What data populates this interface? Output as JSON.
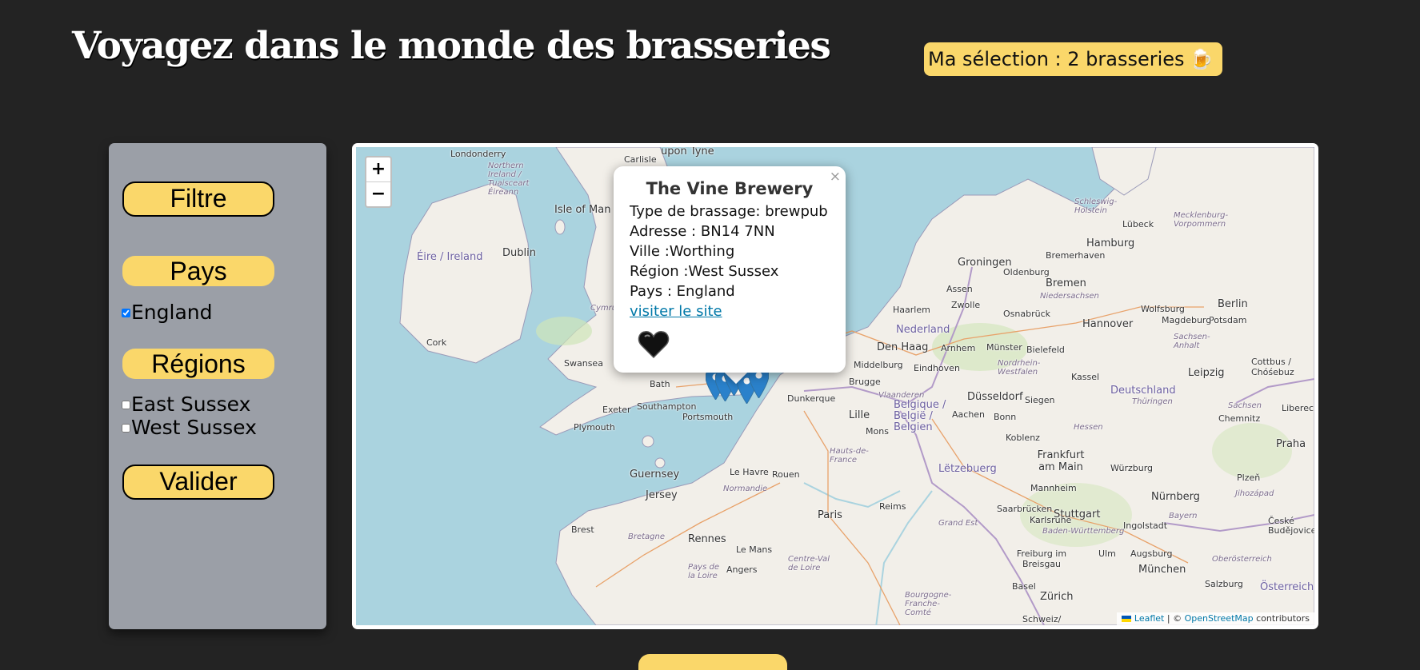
{
  "header": {
    "title": "Voyagez dans le monde des brasseries",
    "selection_label": "Ma sélection : 2 brasseries",
    "selection_icon": "🍺"
  },
  "sidebar": {
    "filter_button": "Filtre",
    "countries_heading": "Pays",
    "countries": [
      {
        "label": "England",
        "checked": true
      }
    ],
    "regions_heading": "Régions",
    "regions": [
      {
        "label": "East Sussex",
        "checked": false
      },
      {
        "label": "West Sussex",
        "checked": false
      }
    ],
    "submit_button": "Valider"
  },
  "map": {
    "zoom_in": "+",
    "zoom_out": "−",
    "places": {
      "londonderry": "Londonderry",
      "carlisle": "Carlisle",
      "upon_tyne": "upon Tyne",
      "northern_ireland": "Northern Ireland / Tuaisceart Éireann",
      "isle_of_man": "Isle of Man",
      "dublin": "Dublin",
      "eire": "Éire / Ireland",
      "cork": "Cork",
      "cymru": "Cymru",
      "swansea": "Swansea",
      "bath": "Bath",
      "exeter": "Exeter",
      "southampton": "Southampton",
      "portsmouth": "Portsmouth",
      "plymouth": "Plymouth",
      "guernsey": "Guernsey",
      "jersey": "Jersey",
      "le_havre": "Le Havre",
      "rouen": "Rouen",
      "normandie": "Normandie",
      "brest": "Brest",
      "bretagne": "Bretagne",
      "rennes": "Rennes",
      "le_mans": "Le Mans",
      "angers": "Angers",
      "pays_de_la_loire": "Pays de la Loire",
      "centre_val": "Centre-Val de Loire",
      "paris": "Paris",
      "reims": "Reims",
      "grand_est": "Grand Est",
      "hauts_de_france": "Hauts-de-France",
      "lille": "Lille",
      "dunkerque": "Dunkerque",
      "belgique": "Belgique / België / Belgien",
      "mons": "Mons",
      "bruxelles": "Brugge",
      "vlaanderen": "Vlaanderen",
      "middelburg": "Middelburg",
      "den_haag": "Den Haag",
      "nederland": "Nederland",
      "haarlem": "Haarlem",
      "zwolle": "Zwolle",
      "assen": "Assen",
      "groningen": "Groningen",
      "arnhem": "Arnhem",
      "eindhoven": "Eindhoven",
      "letzebuerg": "Lëtzebuerg",
      "dusseldorf": "Düsseldorf",
      "aachen": "Aachen",
      "bonn": "Bonn",
      "siegen": "Siegen",
      "koblenz": "Koblenz",
      "munster": "Münster",
      "bielefeld": "Bielefeld",
      "nordrhein": "Nordrhein-Westfalen",
      "hessen": "Hessen",
      "frankfurt": "Frankfurt am Main",
      "mannheim": "Mannheim",
      "saarbrucken": "Saarbrücken",
      "karlsruhe": "Karlsruhe",
      "stuttgart": "Stuttgart",
      "baden": "Baden-Württemberg",
      "freiburg": "Freiburg im Breisgau",
      "basel": "Basel",
      "zurich": "Zürich",
      "schweiz": "Schweiz/",
      "ulm": "Ulm",
      "munchen": "München",
      "augsburg": "Augsburg",
      "bayern": "Bayern",
      "nurnberg": "Nürnberg",
      "wurzburg": "Würzburg",
      "ingolstadt": "Ingolstadt",
      "deutschland": "Deutschland",
      "kassel": "Kassel",
      "hannover": "Hannover",
      "bremen": "Bremen",
      "bremerhaven": "Bremerhaven",
      "oldenburg": "Oldenburg",
      "osnabruck": "Osnabrück",
      "niedersachsen": "Niedersachsen",
      "hamburg": "Hamburg",
      "lubeck": "Lübeck",
      "schleswig": "Schleswig-Holstein",
      "mecklenburg": "Mecklenburg-Vorpommern",
      "berlin": "Berlin",
      "potsdam": "Potsdam",
      "wolfsburg": "Wolfsburg",
      "magdeburg": "Magdeburg",
      "sachsen_anhalt": "Sachsen-Anhalt",
      "leipzig": "Leipzig",
      "cottbus": "Cottbus / Chóśebuz",
      "thuringen": "Thüringen",
      "sachsen": "Sachsen",
      "chemnitz": "Chemnitz",
      "liberec": "Liberec",
      "praha": "Praha",
      "plzen": "Plzeň",
      "jihozapad": "Jihozápad",
      "ceske": "České Budějovice",
      "osterreich": "Österreich",
      "salzburg": "Salzburg",
      "oberosterreich": "Oberösterreich",
      "bourgogne": "Bourgogne-Franche-Comté"
    },
    "attribution_leaflet": "Leaflet",
    "attribution_sep": " | © ",
    "attribution_osm": "OpenStreetMap",
    "attribution_tail": " contributors"
  },
  "popup": {
    "close": "×",
    "title": "The Vine Brewery",
    "type": "Type de brassage: brewpub",
    "address": "Adresse : BN14 7NN",
    "city": "Ville :Worthing",
    "region": "Région :West Sussex",
    "country": "Pays : England",
    "link": "visiter le site"
  },
  "colors": {
    "background": "#232323",
    "accent": "#fad76a",
    "sidebar": "#9b9fa7",
    "water": "#aad3df",
    "land": "#f2efe9",
    "marker": "#2a81cb"
  }
}
